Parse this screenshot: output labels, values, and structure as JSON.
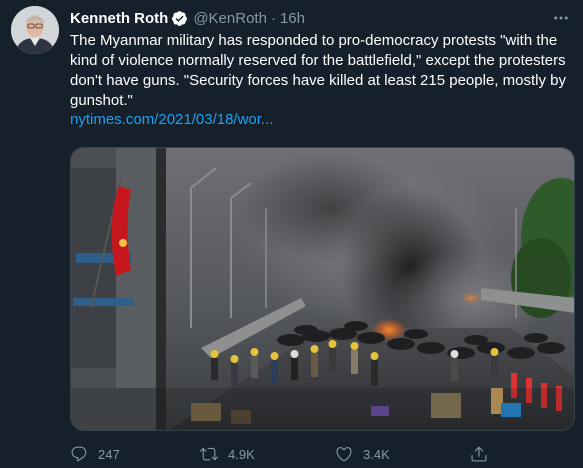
{
  "author": {
    "name": "Kenneth Roth",
    "handle": "@KenRoth",
    "separator": "·",
    "time": "16h"
  },
  "tweet": {
    "text": "The Myanmar military has responded to pro-democracy protests \"with the kind of violence normally reserved for the battlefield,\" except the protesters don't have guns. \"Security forces have killed at least 215 people, mostly by gunshot.\"",
    "link": "nytimes.com/2021/03/18/wor..."
  },
  "actions": {
    "reply_count": "247",
    "retweet_count": "4.9K",
    "like_count": "3.4K"
  },
  "colors": {
    "background": "#15202b",
    "text": "#ffffff",
    "secondary": "#8899a6",
    "link": "#1da1f2",
    "verified": "#1da1f2",
    "flag_red": "#c8161e"
  },
  "icons": [
    "verified-badge-icon",
    "more-icon",
    "reply-icon",
    "retweet-icon",
    "like-icon",
    "share-icon"
  ]
}
